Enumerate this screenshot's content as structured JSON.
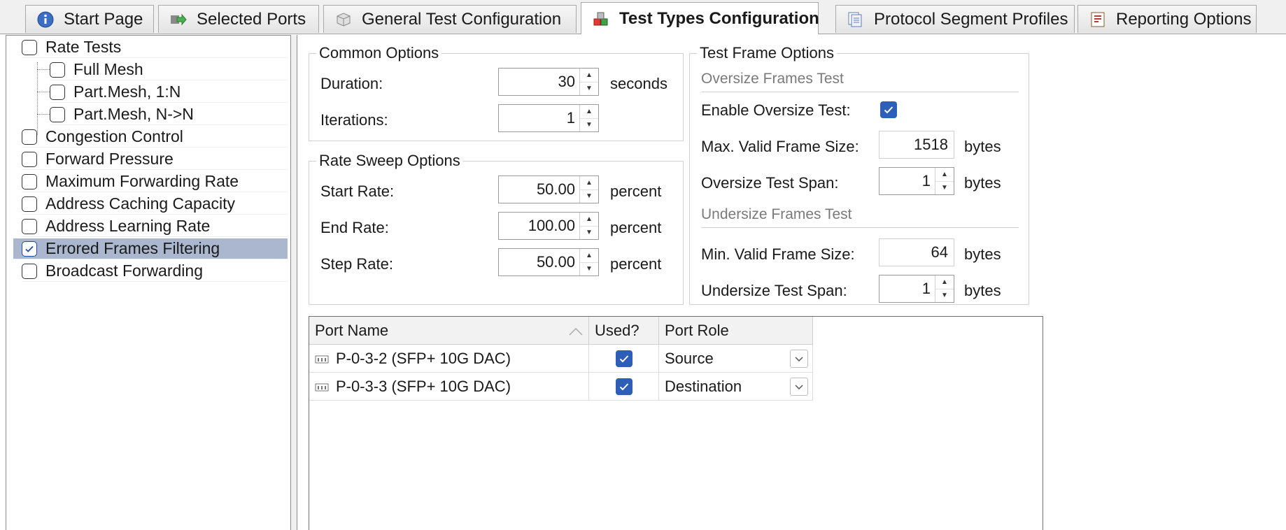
{
  "tabs": [
    {
      "label": "Start Page",
      "icon": "info-icon"
    },
    {
      "label": "Selected Ports",
      "icon": "ports-arrow-icon"
    },
    {
      "label": "General Test Configuration",
      "icon": "box-icon"
    },
    {
      "label": "Test Types Configuration",
      "icon": "cubes-icon",
      "active": true
    },
    {
      "label": "Protocol Segment Profiles",
      "icon": "pages-icon"
    },
    {
      "label": "Reporting Options",
      "icon": "report-icon"
    }
  ],
  "tree": {
    "items": [
      {
        "label": "Rate Tests",
        "checked": false,
        "level": 0
      },
      {
        "label": "Full Mesh",
        "checked": false,
        "level": 1
      },
      {
        "label": "Part.Mesh, 1:N",
        "checked": false,
        "level": 1
      },
      {
        "label": "Part.Mesh, N->N",
        "checked": false,
        "level": 1
      },
      {
        "label": "Congestion Control",
        "checked": false,
        "level": 0
      },
      {
        "label": "Forward Pressure",
        "checked": false,
        "level": 0
      },
      {
        "label": "Maximum Forwarding Rate",
        "checked": false,
        "level": 0
      },
      {
        "label": "Address Caching Capacity",
        "checked": false,
        "level": 0
      },
      {
        "label": "Address Learning Rate",
        "checked": false,
        "level": 0
      },
      {
        "label": "Errored Frames Filtering",
        "checked": true,
        "level": 0,
        "selected": true
      },
      {
        "label": "Broadcast Forwarding",
        "checked": false,
        "level": 0
      }
    ]
  },
  "common_options": {
    "title": "Common Options",
    "duration_label": "Duration:",
    "duration_value": "30",
    "duration_unit": "seconds",
    "iterations_label": "Iterations:",
    "iterations_value": "1"
  },
  "rate_sweep": {
    "title": "Rate Sweep Options",
    "start_label": "Start Rate:",
    "start_value": "50.00",
    "end_label": "End Rate:",
    "end_value": "100.00",
    "step_label": "Step Rate:",
    "step_value": "50.00",
    "unit": "percent"
  },
  "test_frame": {
    "title": "Test Frame Options",
    "oversize_head": "Oversize Frames Test",
    "enable_oversize_label": "Enable Oversize Test:",
    "enable_oversize_checked": true,
    "max_valid_label": "Max. Valid Frame Size:",
    "max_valid_value": "1518",
    "oversize_span_label": "Oversize Test Span:",
    "oversize_span_value": "1",
    "undersize_head": "Undersize Frames Test",
    "min_valid_label": "Min. Valid Frame Size:",
    "min_valid_value": "64",
    "undersize_span_label": "Undersize Test Span:",
    "undersize_span_value": "1",
    "unit": "bytes"
  },
  "ports_grid": {
    "columns": [
      "Port Name",
      "Used?",
      "Port Role"
    ],
    "rows": [
      {
        "name": "P-0-3-2 (SFP+ 10G DAC)",
        "used": true,
        "role": "Source"
      },
      {
        "name": "P-0-3-3 (SFP+ 10G DAC)",
        "used": true,
        "role": "Destination"
      }
    ]
  },
  "colors": {
    "selection": "#aab7cf",
    "check_blue": "#2e5eb8",
    "border": "#8c8c8c"
  }
}
